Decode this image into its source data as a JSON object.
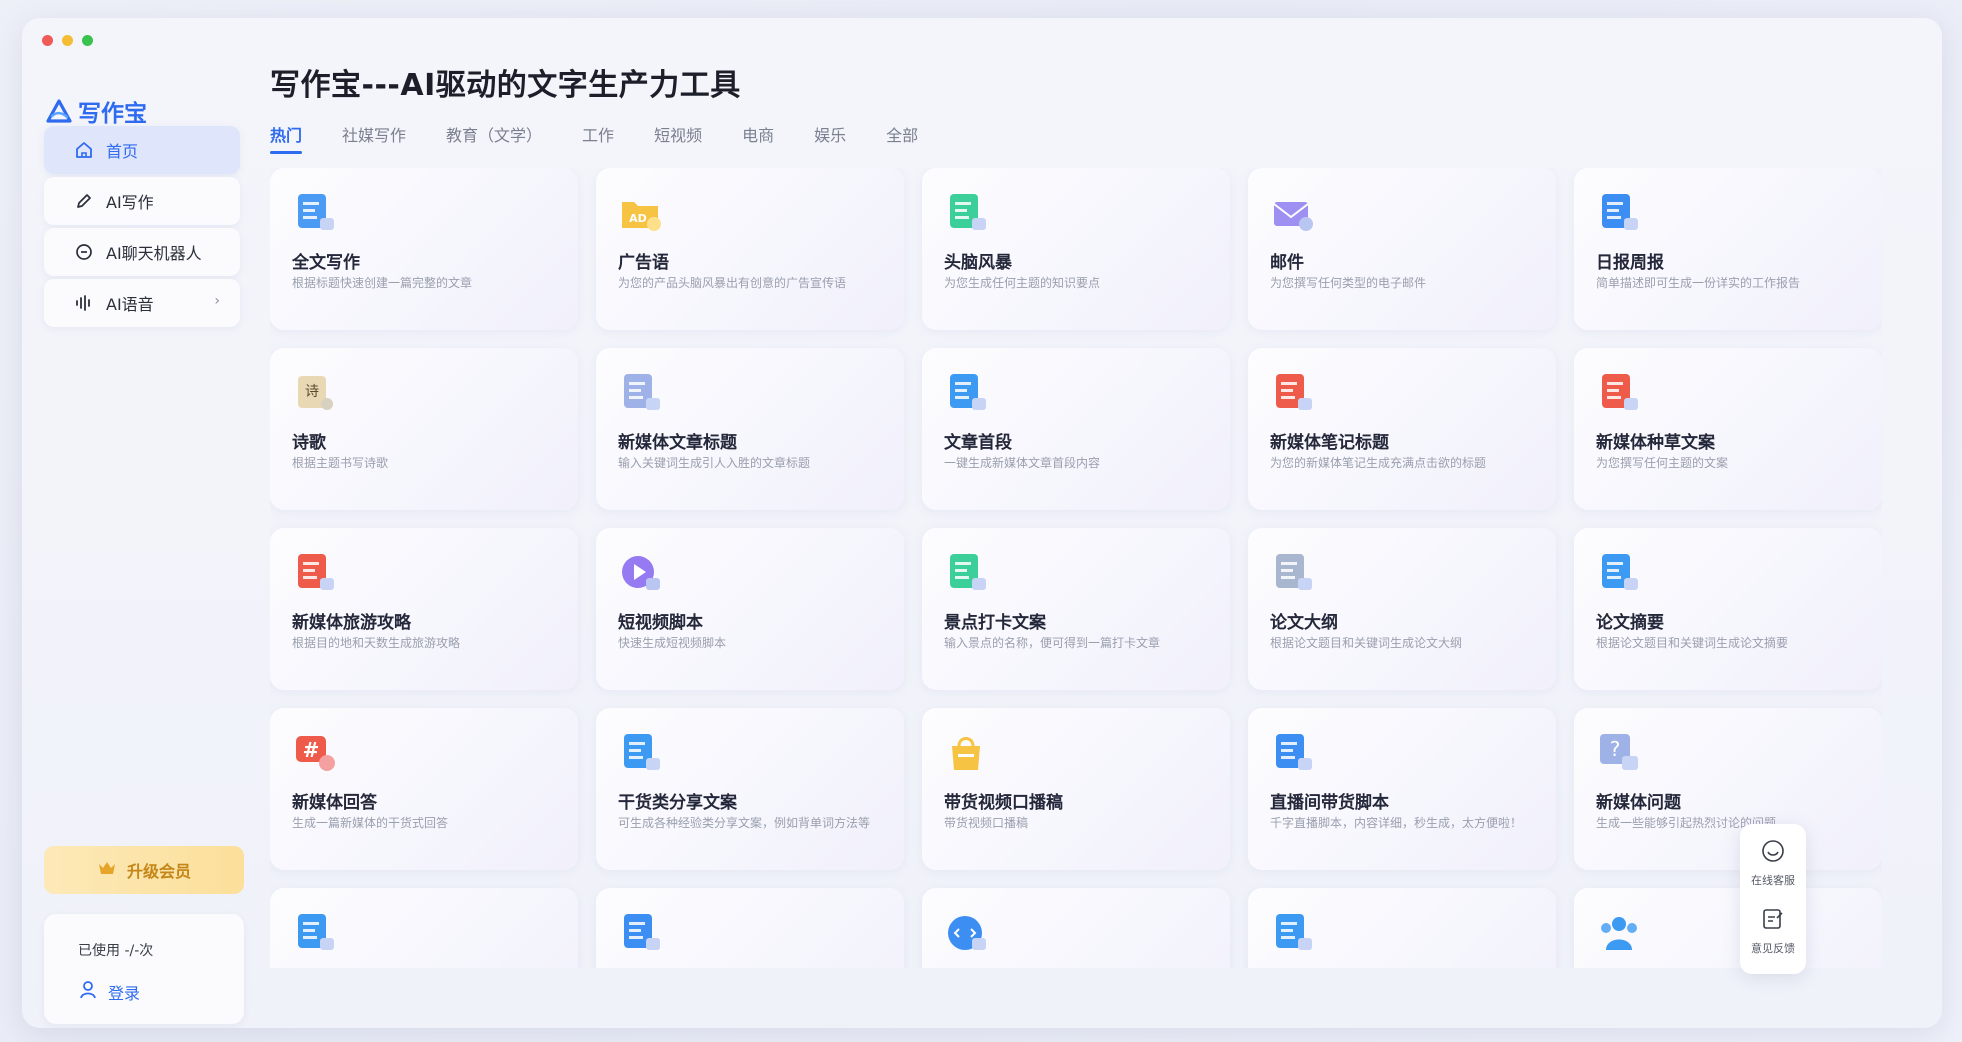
{
  "app": {
    "logo_text": "写作宝"
  },
  "sidebar": {
    "items": [
      {
        "label": "首页",
        "icon": "home-icon",
        "active": true
      },
      {
        "label": "AI写作",
        "icon": "pen-icon",
        "active": false
      },
      {
        "label": "AI聊天机器人",
        "icon": "chat-bubble-icon",
        "active": false
      },
      {
        "label": "AI语音",
        "icon": "sound-wave-icon",
        "active": false,
        "has_chevron": true
      }
    ],
    "upgrade_label": "升级会员",
    "usage_text": "已使用 -/-次",
    "login_label": "登录"
  },
  "main": {
    "title": "写作宝---AI驱动的文字生产力工具",
    "tabs": [
      "热门",
      "社媒写作",
      "教育（文学）",
      "工作",
      "短视频",
      "电商",
      "娱乐",
      "全部"
    ],
    "active_tab": 0,
    "cards": [
      {
        "title": "全文写作",
        "desc": "根据标题快速创建一篇完整的文章",
        "icon": "document-icon",
        "color": "#4b9bf5"
      },
      {
        "title": "广告语",
        "desc": "为您的产品头脑风暴出有创意的广告宣传语",
        "icon": "ad-folder-icon",
        "color": "#f6c343"
      },
      {
        "title": "头脑风暴",
        "desc": "为您生成任何主题的知识要点",
        "icon": "mindmap-icon",
        "color": "#3ccf9a"
      },
      {
        "title": "邮件",
        "desc": "为您撰写任何类型的电子邮件",
        "icon": "mail-icon",
        "color": "#8c7cf0"
      },
      {
        "title": "日报周报",
        "desc": "简单描述即可生成一份详实的工作报告",
        "icon": "report-book-icon",
        "color": "#3c8ef2"
      },
      {
        "title": "诗歌",
        "desc": "根据主题书写诗歌",
        "icon": "poem-scroll-icon",
        "color": "#e8d9b4"
      },
      {
        "title": "新媒体文章标题",
        "desc": "输入关键词生成引人入胜的文章标题",
        "icon": "layout-icon",
        "color": "#9fb2e8"
      },
      {
        "title": "文章首段",
        "desc": "一键生成新媒体文章首段内容",
        "icon": "doc-gear-icon",
        "color": "#3c9af2"
      },
      {
        "title": "新媒体笔记标题",
        "desc": "为您的新媒体笔记生成充满点击欲的标题",
        "icon": "red-book-icon",
        "color": "#ef5b4a"
      },
      {
        "title": "新媒体种草文案",
        "desc": "为您撰写任何主题的文案",
        "icon": "red-book-icon",
        "color": "#ef5b4a"
      },
      {
        "title": "新媒体旅游攻略",
        "desc": "根据目的地和天数生成旅游攻略",
        "icon": "red-book-icon",
        "color": "#ef5b4a"
      },
      {
        "title": "短视频脚本",
        "desc": "快速生成短视频脚本",
        "icon": "play-icon",
        "color": "#8a6cf0"
      },
      {
        "title": "景点打卡文案",
        "desc": "输入景点的名称，便可得到一篇打卡文章",
        "icon": "landmark-icon",
        "color": "#3ccf9a"
      },
      {
        "title": "论文大纲",
        "desc": "根据论文题目和关键词生成论文大纲",
        "icon": "outline-doc-icon",
        "color": "#a9b6cf"
      },
      {
        "title": "论文摘要",
        "desc": "根据论文题目和关键词生成论文摘要",
        "icon": "abstract-doc-icon",
        "color": "#3c9af2"
      },
      {
        "title": "新媒体回答",
        "desc": "生成一篇新媒体的干货式回答",
        "icon": "hashtag-icon",
        "color": "#ef5b4a"
      },
      {
        "title": "干货类分享文案",
        "desc": "可生成各种经验类分享文案，例如背单词方法等",
        "icon": "share-icon",
        "color": "#3c9af2"
      },
      {
        "title": "带货视频口播稿",
        "desc": "带货视频口播稿",
        "icon": "shopping-bag-icon",
        "color": "#f6c343"
      },
      {
        "title": "直播间带货脚本",
        "desc": "千字直播脚本，内容详细，秒生成，太方便啦！",
        "icon": "live-screen-icon",
        "color": "#3c8ef2"
      },
      {
        "title": "新媒体问题",
        "desc": "生成一些能够引起热烈讨论的问题",
        "icon": "question-icon",
        "color": "#9fb2e8"
      },
      {
        "title": "",
        "desc": "",
        "icon": "video-bulb-icon",
        "color": "#3c9af2"
      },
      {
        "title": "",
        "desc": "",
        "icon": "film-5s-icon",
        "color": "#3c8ef2"
      },
      {
        "title": "",
        "desc": "",
        "icon": "code-icon",
        "color": "#3c8ef2"
      },
      {
        "title": "",
        "desc": "",
        "icon": "doc-cart-icon",
        "color": "#3c9af2"
      },
      {
        "title": "",
        "desc": "",
        "icon": "people-icon",
        "color": "#3c9af2"
      }
    ]
  },
  "float_panel": {
    "service_label": "在线客服",
    "feedback_label": "意见反馈"
  },
  "colors": {
    "accent": "#2f6bf0",
    "upgrade_text": "#c48618"
  }
}
